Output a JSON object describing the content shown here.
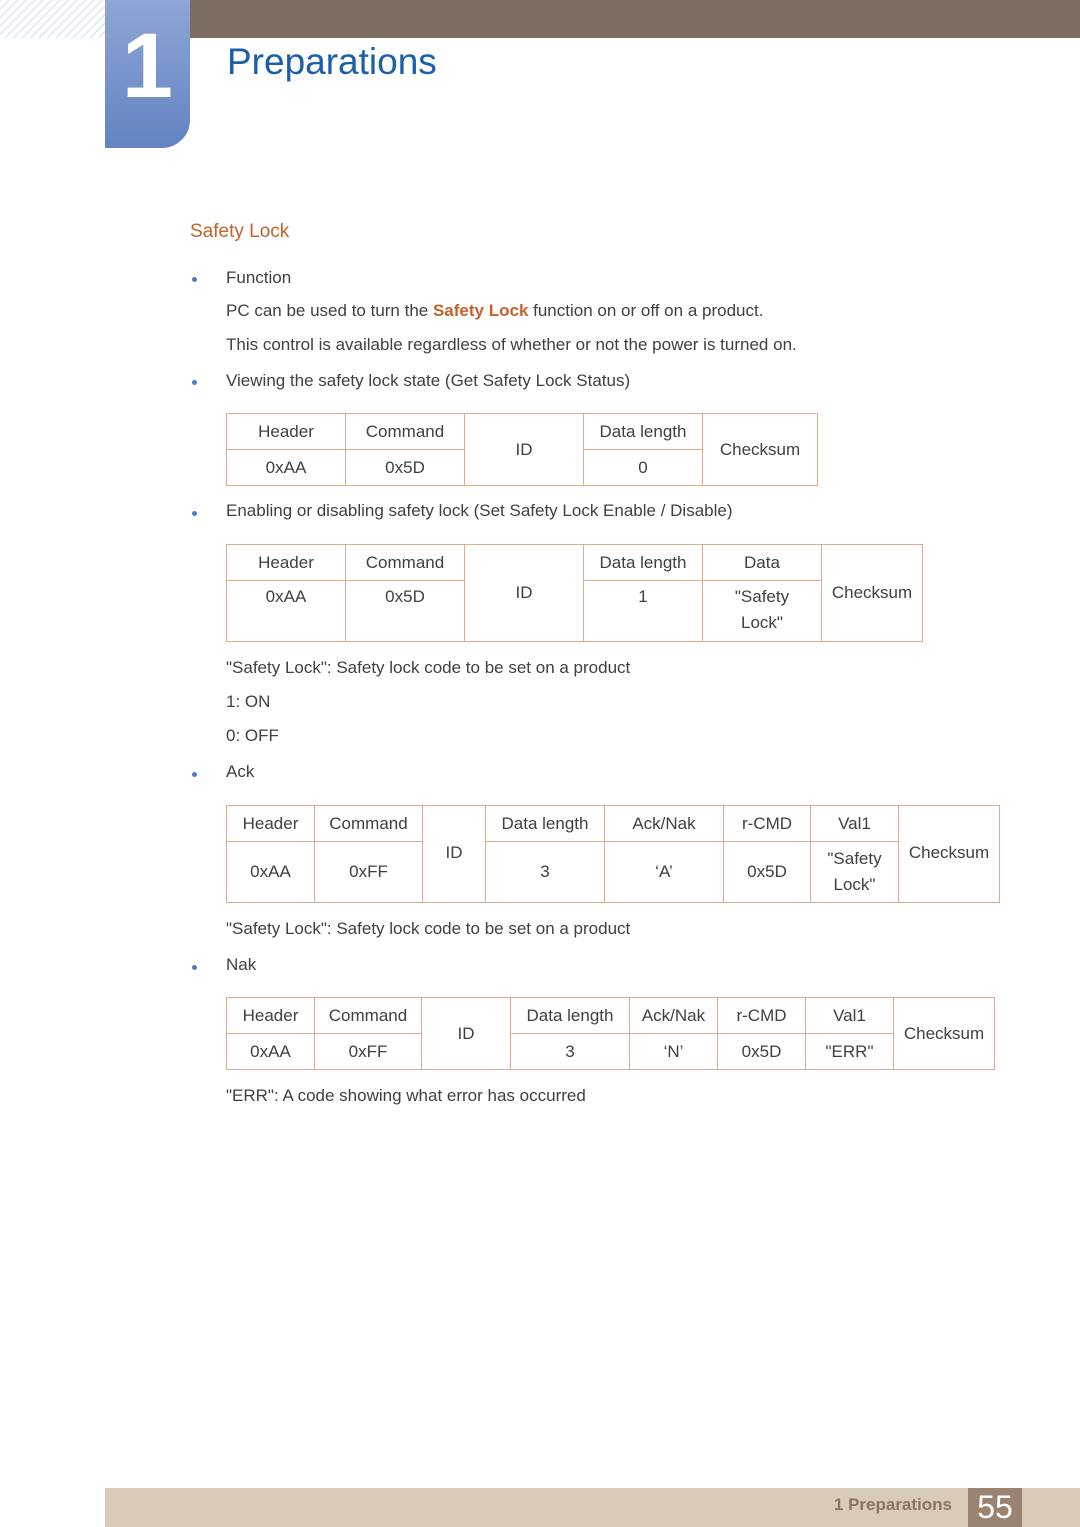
{
  "header": {
    "chapter_number": "1",
    "chapter_title": "Preparations",
    "colors": {
      "topbar": "#7c6d60",
      "chapter_box": "#6f8dca",
      "title": "#1a5fa8"
    }
  },
  "section": {
    "title": "Safety Lock",
    "accent_color": "#c4622a"
  },
  "content": {
    "function_label": "Function",
    "function_desc_pre": "PC can be used to turn the ",
    "function_desc_highlight": "Safety Lock",
    "function_desc_post": " function on or off on a product.",
    "function_note": "This control is available regardless of whether or not the power is turned on.",
    "get_label": "Viewing the safety lock state (Get Safety Lock Status)",
    "set_label": "Enabling or disabling safety lock (Set Safety Lock Enable / Disable)",
    "set_note": "\"Safety Lock\": Safety lock code to be set on a product",
    "on_value": "1: ON",
    "off_value": "0: OFF",
    "ack_label": "Ack",
    "ack_note": "\"Safety Lock\": Safety lock code to be set on a product",
    "nak_label": "Nak",
    "nak_note": "\"ERR\": A code showing what error has occurred"
  },
  "tables": {
    "get": {
      "headers": [
        "Header",
        "Command",
        "ID",
        "Data length",
        "Checksum"
      ],
      "values": [
        "0xAA",
        "0x5D",
        "0"
      ]
    },
    "set": {
      "headers": [
        "Header",
        "Command",
        "ID",
        "Data length",
        "Data",
        "Checksum"
      ],
      "values": [
        "0xAA",
        "0x5D",
        "1",
        "\"Safety Lock\""
      ]
    },
    "ack": {
      "headers": [
        "Header",
        "Command",
        "ID",
        "Data length",
        "Ack/Nak",
        "r-CMD",
        "Val1",
        "Checksum"
      ],
      "values": [
        "0xAA",
        "0xFF",
        "3",
        "‘A’",
        "0x5D",
        "\"Safety Lock\""
      ]
    },
    "nak": {
      "headers": [
        "Header",
        "Command",
        "ID",
        "Data length",
        "Ack/Nak",
        "r-CMD",
        "Val1",
        "Checksum"
      ],
      "values": [
        "0xAA",
        "0xFF",
        "3",
        "‘N’",
        "0x5D",
        "\"ERR\""
      ]
    }
  },
  "footer": {
    "label": "1 Preparations",
    "page_number": "55"
  }
}
